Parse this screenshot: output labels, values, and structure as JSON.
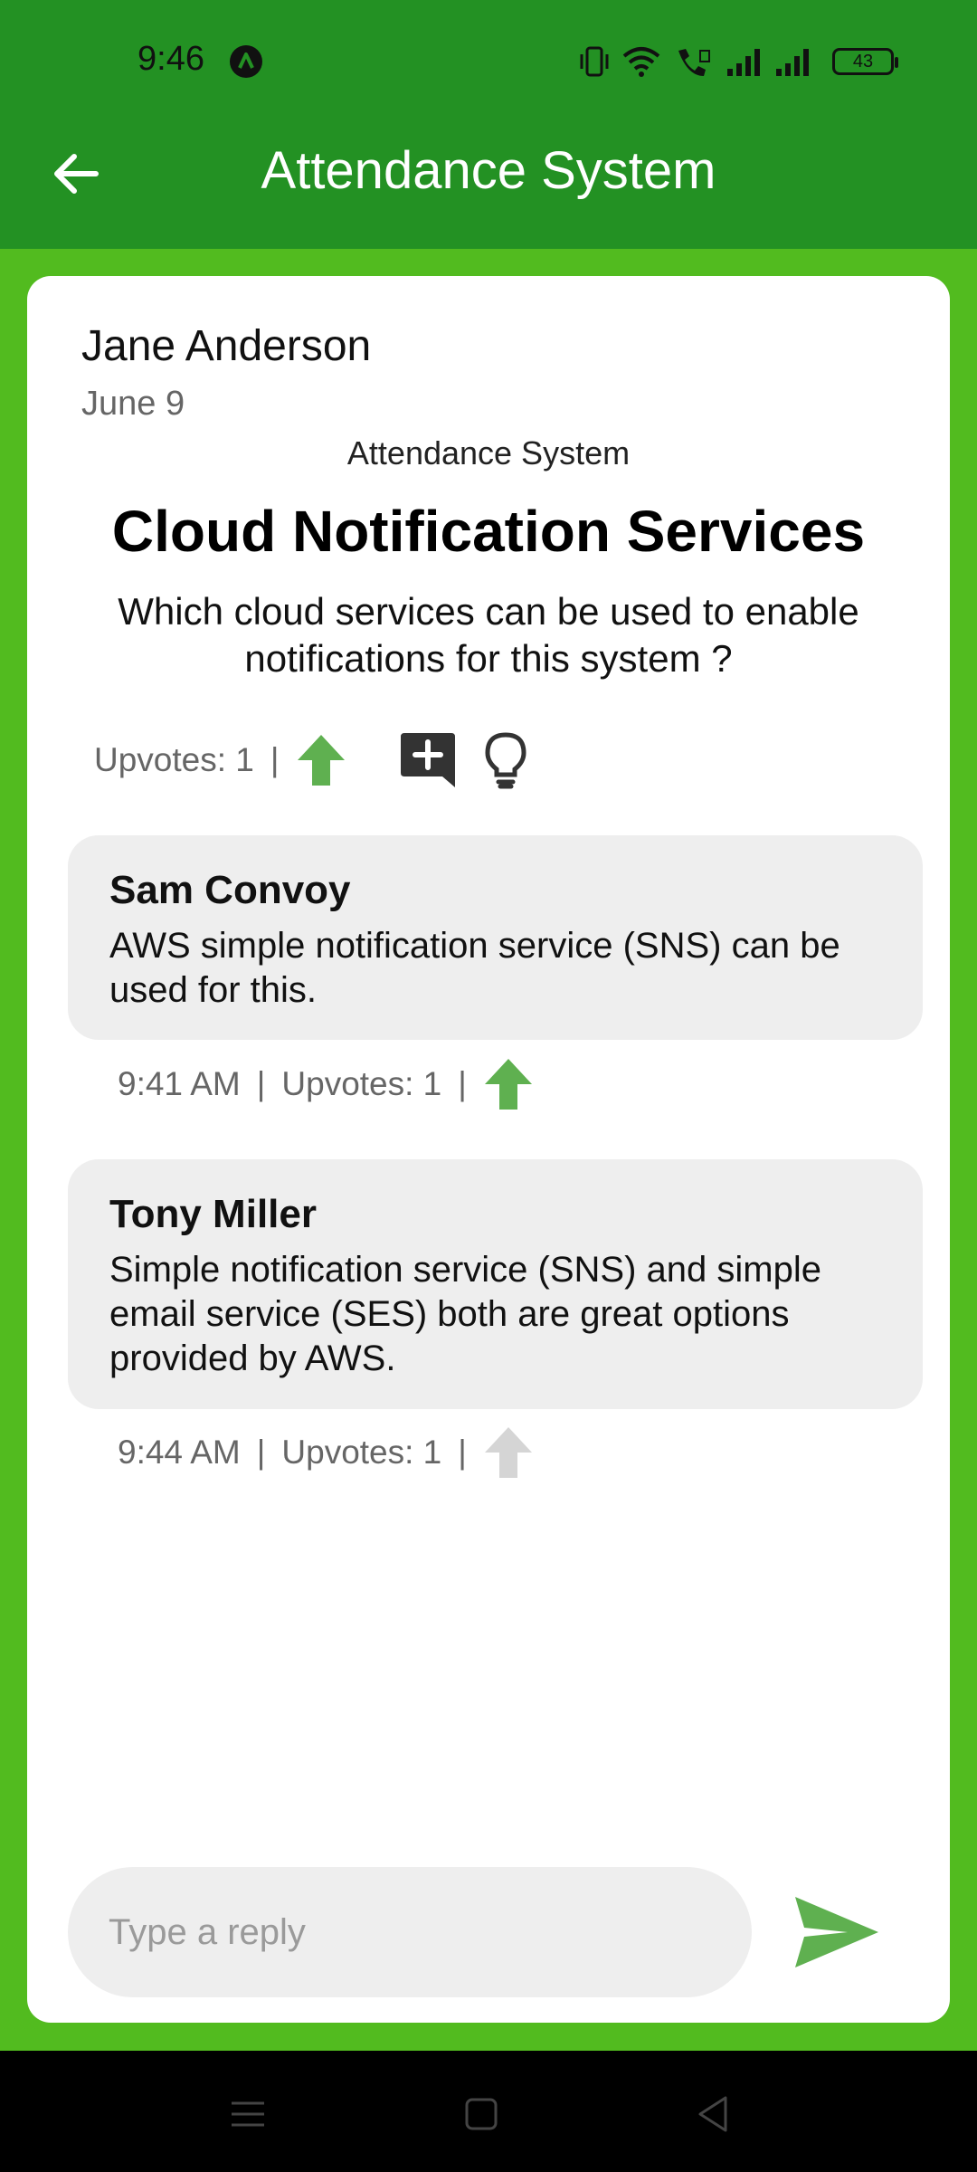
{
  "status_bar": {
    "time": "9:46",
    "battery": "43"
  },
  "app_bar": {
    "title": "Attendance System",
    "back_icon": "arrow-left-icon"
  },
  "question": {
    "author": "Jane Anderson",
    "date": "June 9",
    "system": "Attendance System",
    "title": "Cloud Notification Services",
    "body": "Which cloud services can be used to enable notifications for this system ?",
    "upvotes_label": "Upvotes: 1",
    "separator": "|"
  },
  "answers": [
    {
      "name": "Sam Convoy",
      "text": "AWS simple notification service (SNS) can be used for this.",
      "time": "9:41 AM",
      "upvotes_label": "Upvotes: 1",
      "upvoted": true
    },
    {
      "name": "Tony Miller",
      "text": "Simple notification service (SNS) and simple email service (SES) both are great options provided by AWS.",
      "time": "9:44 AM",
      "upvotes_label": "Upvotes: 1",
      "upvoted": false
    }
  ],
  "reply": {
    "placeholder": "Type a reply",
    "value": ""
  },
  "colors": {
    "header": "#239123",
    "background": "#52bb1f",
    "upvote_active": "#5fb050",
    "upvote_inactive": "#d5d5d5"
  },
  "icons": {
    "upvote": "arrow-up-icon",
    "add_comment": "add-comment-icon",
    "hint": "lightbulb-icon",
    "send": "send-icon"
  }
}
